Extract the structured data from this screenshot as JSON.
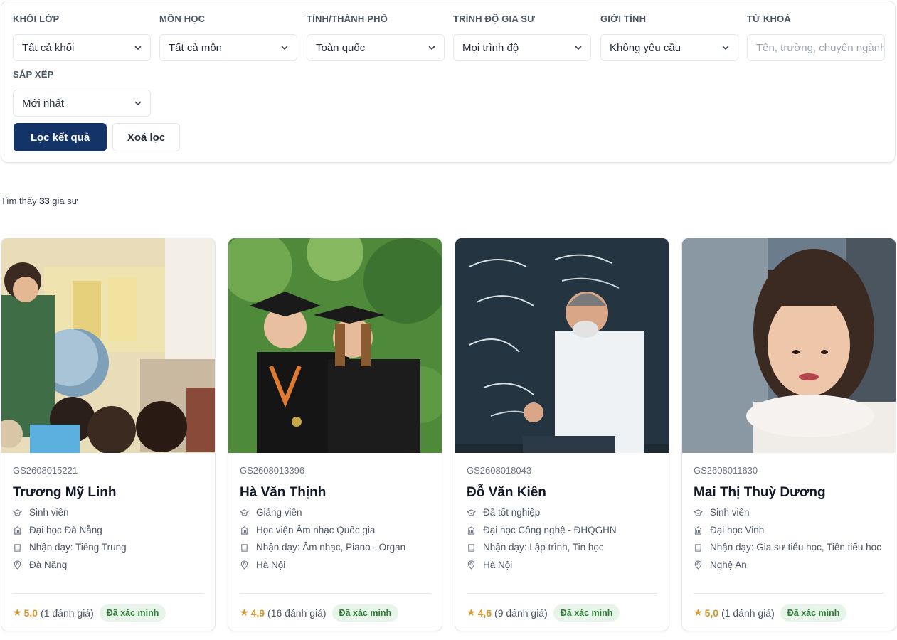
{
  "filters": {
    "grade": {
      "label": "KHỐI LỚP",
      "value": "Tất cả khối"
    },
    "subject": {
      "label": "MÔN HỌC",
      "value": "Tất cả môn"
    },
    "province": {
      "label": "TỈNH/THÀNH PHỐ",
      "value": "Toàn quốc"
    },
    "level": {
      "label": "TRÌNH ĐỘ GIA SƯ",
      "value": "Mọi trình độ"
    },
    "gender": {
      "label": "GIỚI TÍNH",
      "value": "Không yêu cầu"
    },
    "keyword": {
      "label": "TỪ KHOÁ",
      "placeholder": "Tên, trường, chuyên ngành..."
    },
    "sort": {
      "label": "SẮP XẾP",
      "value": "Mới nhất"
    },
    "apply_label": "Lọc kết quả",
    "clear_label": "Xoá lọc"
  },
  "results": {
    "prefix": "Tìm thấy",
    "count": "33",
    "suffix": "gia sư"
  },
  "colors": {
    "primary": "#143468",
    "star": "#d4952b",
    "verified_bg": "#e6f4ea",
    "verified_text": "#2e7d32"
  },
  "tutors": [
    {
      "code": "GS2608015221",
      "name": "Trương Mỹ Linh",
      "status": "Sinh viên",
      "school": "Đại học Đà Nẵng",
      "subjects": "Nhận dạy: Tiếng Trung",
      "location": "Đà Nẵng",
      "rating": "5,0",
      "reviews": "(1 đánh giá)",
      "badge": "Đã xác minh",
      "photo": "teacher-with-globe-classroom"
    },
    {
      "code": "GS2608013396",
      "name": "Hà Văn Thịnh",
      "status": "Giảng viên",
      "school": "Học viện Âm nhạc Quốc gia",
      "subjects": "Nhận dạy: Âm nhạc, Piano - Organ",
      "location": "Hà Nội",
      "rating": "4,9",
      "reviews": "(16 đánh giá)",
      "badge": "Đã xác minh",
      "photo": "graduates-in-caps"
    },
    {
      "code": "GS2608018043",
      "name": "Đỗ Văn Kiên",
      "status": "Đã tốt nghiệp",
      "school": "Đại học Công nghệ - ĐHQGHN",
      "subjects": "Nhận dạy: Lập trình, Tin học",
      "location": "Hà Nội",
      "rating": "4,6",
      "reviews": "(9 đánh giá)",
      "badge": "Đã xác minh",
      "photo": "professor-at-chalkboard"
    },
    {
      "code": "GS2608011630",
      "name": "Mai Thị Thuỳ Dương",
      "status": "Sinh viên",
      "school": "Đại học Vinh",
      "subjects": "Nhận dạy: Gia sư tiểu học, Tiền tiểu học",
      "location": "Nghệ An",
      "rating": "5,0",
      "reviews": "(1 đánh giá)",
      "badge": "Đã xác minh",
      "photo": "young-woman-portrait"
    }
  ]
}
